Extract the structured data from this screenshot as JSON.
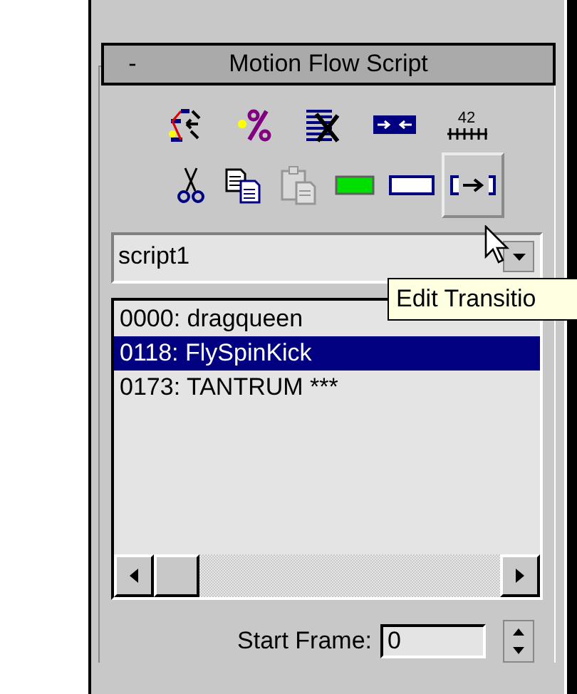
{
  "rollout": {
    "collapse_sign": "-",
    "title": "Motion Flow Script",
    "expanded": true
  },
  "toolbar_rows": [
    [
      {
        "kind": "transitions",
        "disabled": false,
        "raised": false
      },
      {
        "kind": "percent",
        "disabled": false,
        "raised": false
      },
      {
        "kind": "delete-clip",
        "disabled": false,
        "raised": false
      },
      {
        "kind": "compress",
        "disabled": false,
        "raised": false
      },
      {
        "kind": "ruler",
        "label": "42",
        "disabled": false,
        "raised": false
      }
    ],
    [
      {
        "kind": "cut",
        "disabled": false,
        "raised": false
      },
      {
        "kind": "copy",
        "disabled": false,
        "raised": false
      },
      {
        "kind": "paste",
        "disabled": true,
        "raised": false
      },
      {
        "kind": "filled-clip",
        "disabled": false,
        "raised": false
      },
      {
        "kind": "empty-clip",
        "disabled": false,
        "raised": false
      },
      {
        "kind": "edit-transition",
        "disabled": false,
        "raised": true
      }
    ]
  ],
  "script_dropdown": {
    "value": "script1"
  },
  "tooltip": {
    "text": "Edit Transitio"
  },
  "clip_list": [
    {
      "text": "0000: dragqueen",
      "selected": false
    },
    {
      "text": "0118: FlySpinKick",
      "selected": true
    },
    {
      "text": "0173: TANTRUM ***",
      "selected": false
    }
  ],
  "start_frame": {
    "label": "Start Frame:",
    "value": "0"
  }
}
